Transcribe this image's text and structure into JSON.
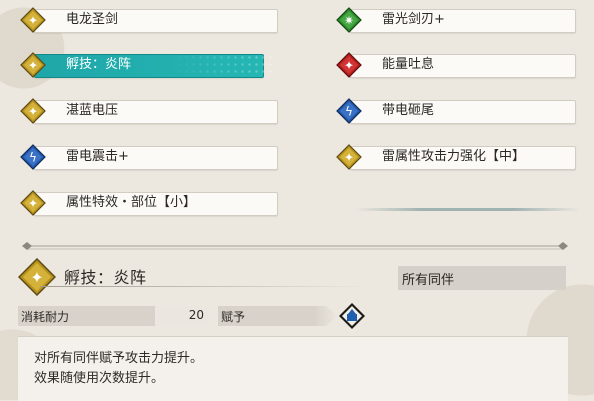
{
  "skills_left": [
    {
      "label": "电龙圣剑",
      "gem": "gold",
      "icon": "skill-emblem-icon",
      "selected": false
    },
    {
      "label": "孵技：炎阵",
      "gem": "gold",
      "icon": "skill-emblem-icon",
      "selected": true
    },
    {
      "label": "湛蓝电压",
      "gem": "gold",
      "icon": "skill-emblem-icon",
      "selected": false
    },
    {
      "label": "雷电震击+",
      "gem": "blue",
      "icon": "lightning-icon",
      "selected": false
    },
    {
      "label": "属性特效・部位【小】",
      "gem": "gold",
      "icon": "skill-emblem-icon",
      "selected": false
    }
  ],
  "skills_right": [
    {
      "label": "雷光剑刃+",
      "gem": "green",
      "icon": "sparkle-icon",
      "selected": false
    },
    {
      "label": "能量吐息",
      "gem": "red",
      "icon": "skill-emblem-icon",
      "selected": false
    },
    {
      "label": "带电砸尾",
      "gem": "blue",
      "icon": "lightning-icon",
      "selected": false
    },
    {
      "label": "雷属性攻击力强化【中】",
      "gem": "gold",
      "icon": "skill-emblem-icon",
      "selected": false
    }
  ],
  "detail": {
    "title": "孵技：炎阵",
    "target": "所有同伴",
    "cost_label": "消耗耐力",
    "cost_value": "20",
    "grant_label": "赋予",
    "description_line1": "对所有同伴赋予攻击力提升。",
    "description_line2": "效果随使用次数提升。"
  },
  "colors": {
    "selected_teal": "#23b0ae",
    "gem_gold": "#b8941e",
    "gem_blue": "#2458a8",
    "gem_green": "#2f8a2e",
    "gem_red": "#b51d1d"
  }
}
